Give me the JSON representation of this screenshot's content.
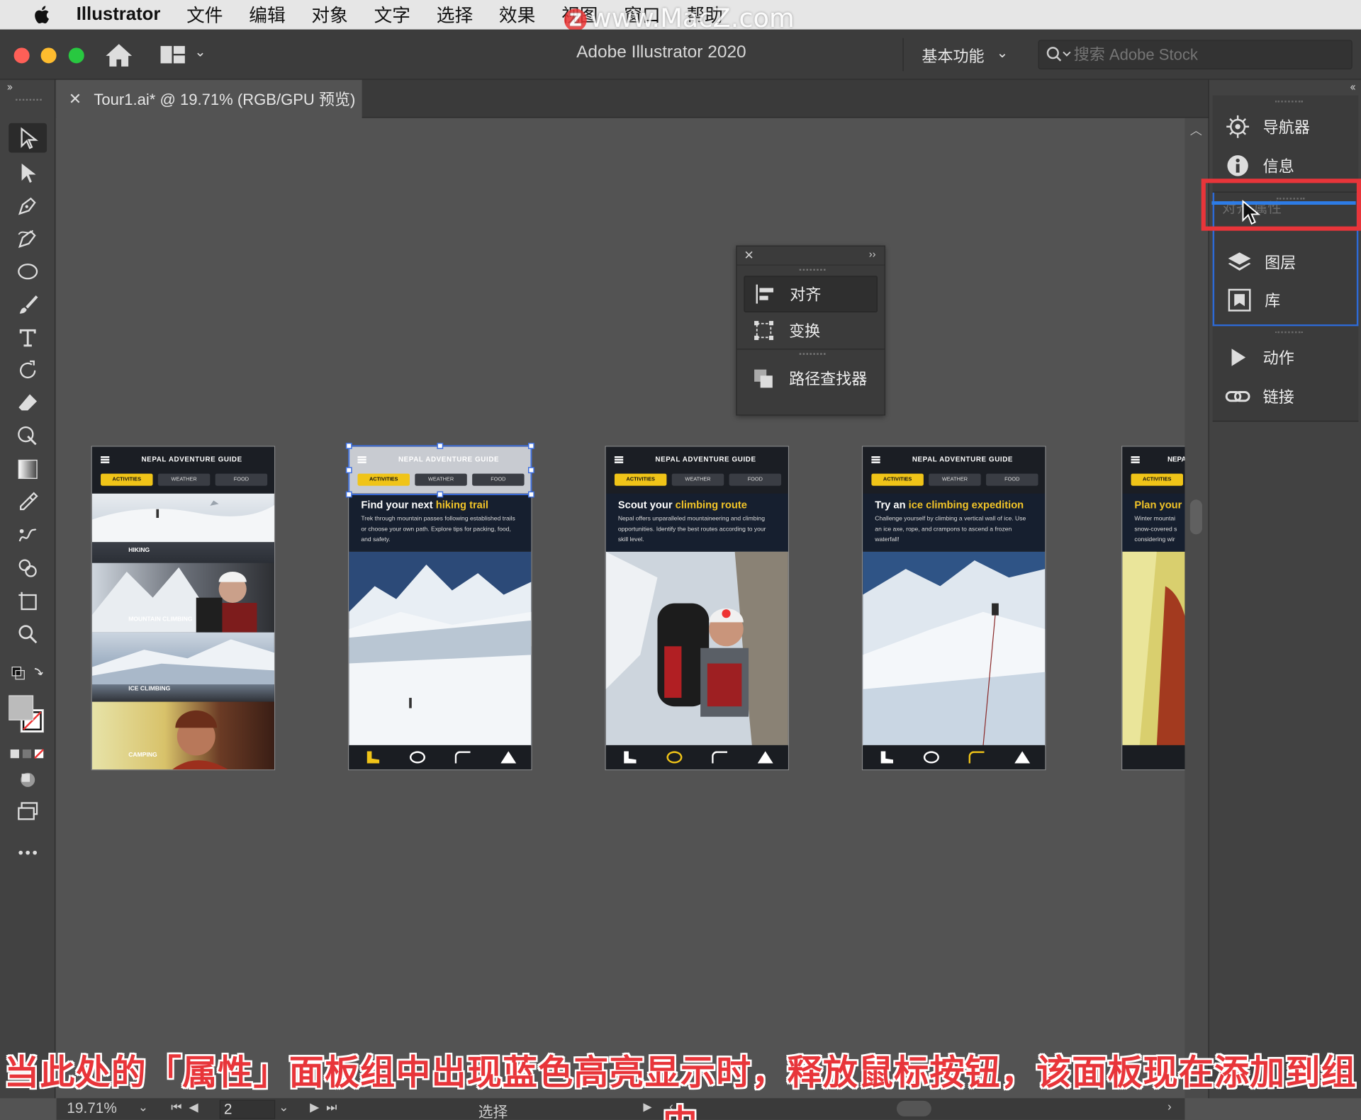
{
  "menubar": {
    "app_name": "Illustrator",
    "items": [
      "文件",
      "编辑",
      "对象",
      "文字",
      "选择",
      "效果",
      "视图",
      "窗口",
      "帮助"
    ],
    "watermark": "www.MacZ.com",
    "watermark_badge": "Z"
  },
  "titlebar": {
    "title": "Adobe Illustrator 2020",
    "workspace": "基本功能",
    "search_placeholder": "搜索 Adobe Stock"
  },
  "document": {
    "tab_title": "Tour1.ai* @ 19.71% (RGB/GPU 预览)"
  },
  "tools": [
    "selection-tool",
    "direct-selection-tool",
    "pen-tool",
    "curvature-tool",
    "ellipse-tool",
    "paintbrush-tool",
    "type-tool",
    "rotate-tool",
    "eraser-tool",
    "puppet-warp-tool",
    "gradient-tool",
    "eyedropper-tool",
    "blend-tool",
    "shape-builder-tool",
    "artboard-tool",
    "zoom-tool"
  ],
  "float_panel": {
    "items": [
      {
        "label": "对齐",
        "icon": "align-icon",
        "selected": true
      },
      {
        "label": "变换",
        "icon": "transform-icon",
        "selected": false
      },
      {
        "label": "路径查找器",
        "icon": "pathfinder-icon",
        "selected": false
      }
    ]
  },
  "right_dock": {
    "group1": [
      {
        "label": "导航器",
        "icon": "navigator-icon"
      },
      {
        "label": "信息",
        "icon": "info-icon"
      }
    ],
    "ghost_labels": [
      "对齐",
      "属性"
    ],
    "group2": [
      {
        "label": "图层",
        "icon": "layers-icon"
      },
      {
        "label": "库",
        "icon": "libraries-icon"
      }
    ],
    "group3": [
      {
        "label": "动作",
        "icon": "actions-icon"
      },
      {
        "label": "链接",
        "icon": "links-icon"
      }
    ]
  },
  "artboards": {
    "guide_title": "NEPAL ADVENTURE GUIDE",
    "tabs": [
      "ACTIVITIES",
      "WEATHER",
      "FOOD"
    ],
    "categories": [
      "HIKING",
      "MOUNTAIN CLIMBING",
      "ICE CLIMBING",
      "CAMPING"
    ],
    "screens": [
      {
        "h_plain": "Find your next ",
        "h_em": "hiking trail",
        "body": "Trek through mountain passes following established trails or choose your own path. Explore tips for packing, food, and safety."
      },
      {
        "h_plain": "Scout your ",
        "h_em": "climbing route",
        "body": "Nepal offers unparalleled mountaineering and climbing opportunities. Identify the best routes according to your skill level."
      },
      {
        "h_plain": "Try an ",
        "h_em": "ice climbing expedition",
        "body": "Challenge yourself by climbing a vertical wall of ice. Use an ice axe, rope, and crampons to ascend a frozen waterfall!"
      },
      {
        "h_plain": "Plan your ",
        "h_em": "",
        "body": "Winter mountai snow-covered s considering wir"
      }
    ],
    "partial_title": "NEPA"
  },
  "statusbar": {
    "zoom": "19.71%",
    "page": "2",
    "mode": "选择"
  },
  "caption": "当此处的「属性」面板组中出现蓝色高亮显示时，释放鼠标按钮，该面板现在添加到组中",
  "colors": {
    "accent_red": "#e8353a",
    "highlight_blue": "#2d7ce6",
    "guide_yellow": "#f0c418"
  }
}
